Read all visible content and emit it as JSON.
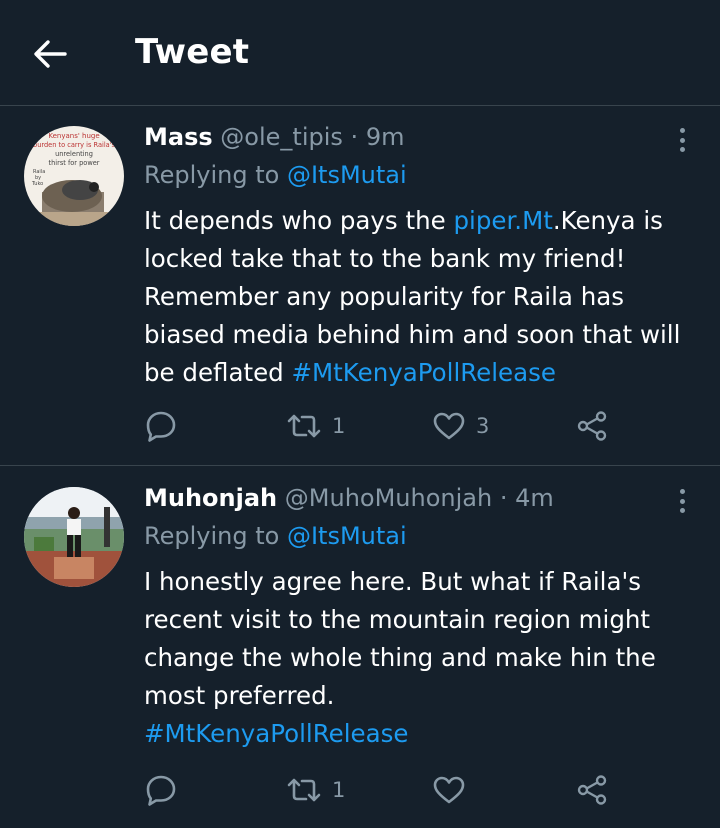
{
  "header": {
    "title": "Tweet"
  },
  "tweets": [
    {
      "name": "Mass",
      "handle": "@ole_tipis",
      "dot": "·",
      "time": "9m",
      "replying_prefix": "Replying to",
      "replying_to": "@ItsMutai",
      "body_pre": "It depends who pays the ",
      "body_link": "piper.Mt",
      "body_mid": ".Kenya is locked take that to the bank my friend! Remember any popularity for Raila has biased media behind him and soon that will be deflated ",
      "hashtag": "#MtKenyaPollRelease",
      "avatar_text": [
        "Kenyans' huge",
        "burden to carry is Raila's",
        "unrelenting",
        "thirst for power",
        "Raila",
        "by",
        "Tuko"
      ],
      "retweets": "1",
      "likes": "3"
    },
    {
      "name": "Muhonjah",
      "handle": "@MuhoMuhonjah",
      "dot": "·",
      "time": "4m",
      "replying_prefix": "Replying to",
      "replying_to": "@ItsMutai",
      "body_text": "I honestly agree here. But what if Raila's recent visit to the mountain region might change the whole thing and make hin the most preferred.",
      "hashtag": "#MtKenyaPollRelease",
      "retweets": "1",
      "likes": ""
    }
  ],
  "colors": {
    "background": "#15202b",
    "secondary": "#8899a6",
    "accent": "#1d9bf0",
    "divider": "#38444d"
  },
  "icons": [
    "back-arrow-icon",
    "more-vertical-icon",
    "reply-icon",
    "retweet-icon",
    "like-icon",
    "share-icon"
  ]
}
